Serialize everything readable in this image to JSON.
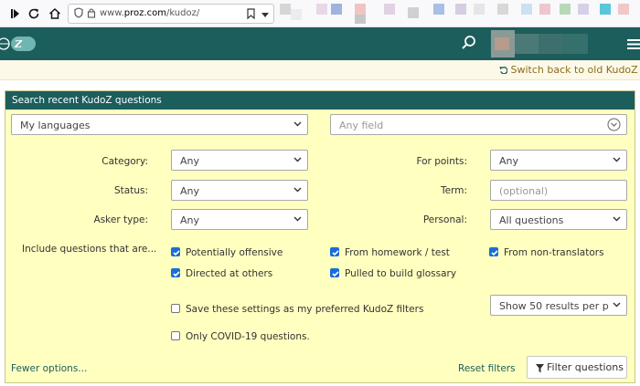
{
  "browser": {
    "url_prefix": "www.",
    "url_domain": "proz.com",
    "url_path": "/kudoz/"
  },
  "header": {
    "logo_text": "Z"
  },
  "switch_link": "Switch back to old KudoZ int",
  "panel": {
    "title": "Search recent KudoZ questions",
    "languages_select": "My languages",
    "field_select_placeholder": "Any field"
  },
  "filters": {
    "category_label": "Category:",
    "category_value": "Any",
    "status_label": "Status:",
    "status_value": "Any",
    "asker_label": "Asker type:",
    "asker_value": "Any",
    "points_label": "For points:",
    "points_value": "Any",
    "term_label": "Term:",
    "term_placeholder": "(optional)",
    "personal_label": "Personal:",
    "personal_value": "All questions"
  },
  "include": {
    "label": "Include questions that are...",
    "items": [
      {
        "label": "Potentially offensive",
        "checked": true
      },
      {
        "label": "From homework / test",
        "checked": true
      },
      {
        "label": "From non-translators",
        "checked": true
      },
      {
        "label": "Directed at others",
        "checked": true
      },
      {
        "label": "Pulled to build glossary",
        "checked": true
      }
    ]
  },
  "options": {
    "save_settings_label": "Save these settings as my preferred KudoZ filters",
    "save_settings_checked": false,
    "covid_label": "Only COVID-19 questions.",
    "covid_checked": false,
    "results_select": "Show 50 results per p"
  },
  "footer": {
    "fewer_options": "Fewer options...",
    "reset_filters": "Reset filters",
    "filter_button": "Filter questions"
  },
  "colors": {
    "brand_teal": "#1c5e5c",
    "panel_bg": "#ffffc0",
    "checkbox_blue": "#1a6ed8",
    "switch_link": "#8a6d1e"
  }
}
